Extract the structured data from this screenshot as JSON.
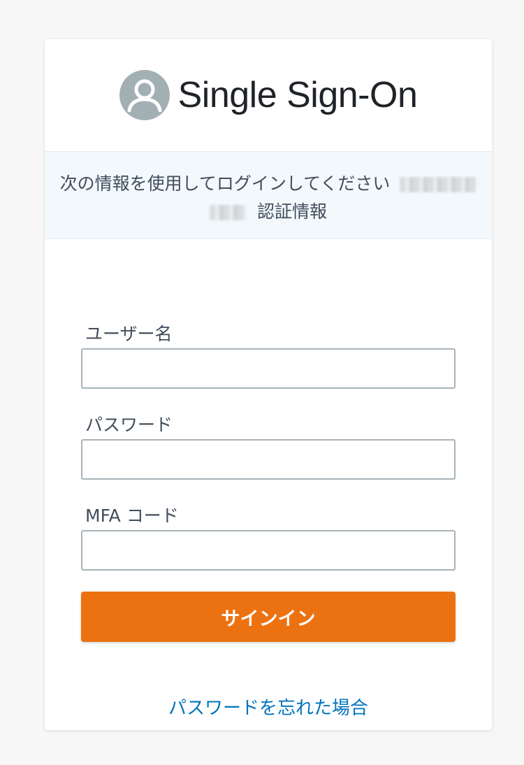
{
  "header": {
    "title": "Single Sign-On",
    "icon": "user-avatar-icon"
  },
  "banner": {
    "line1": "次の情報を使用してログインしてください",
    "line2": "認証情報"
  },
  "form": {
    "username_label": "ユーザー名",
    "username_value": "",
    "password_label": "パスワード",
    "password_value": "",
    "mfa_label": "MFA コード",
    "mfa_value": "",
    "signin_label": "サインイン",
    "forgot_label": "パスワードを忘れた場合"
  },
  "colors": {
    "accent": "#ec7211",
    "link": "#0073bb",
    "banner_bg": "#f2f8fc",
    "avatar_bg": "#a3b0b3"
  }
}
